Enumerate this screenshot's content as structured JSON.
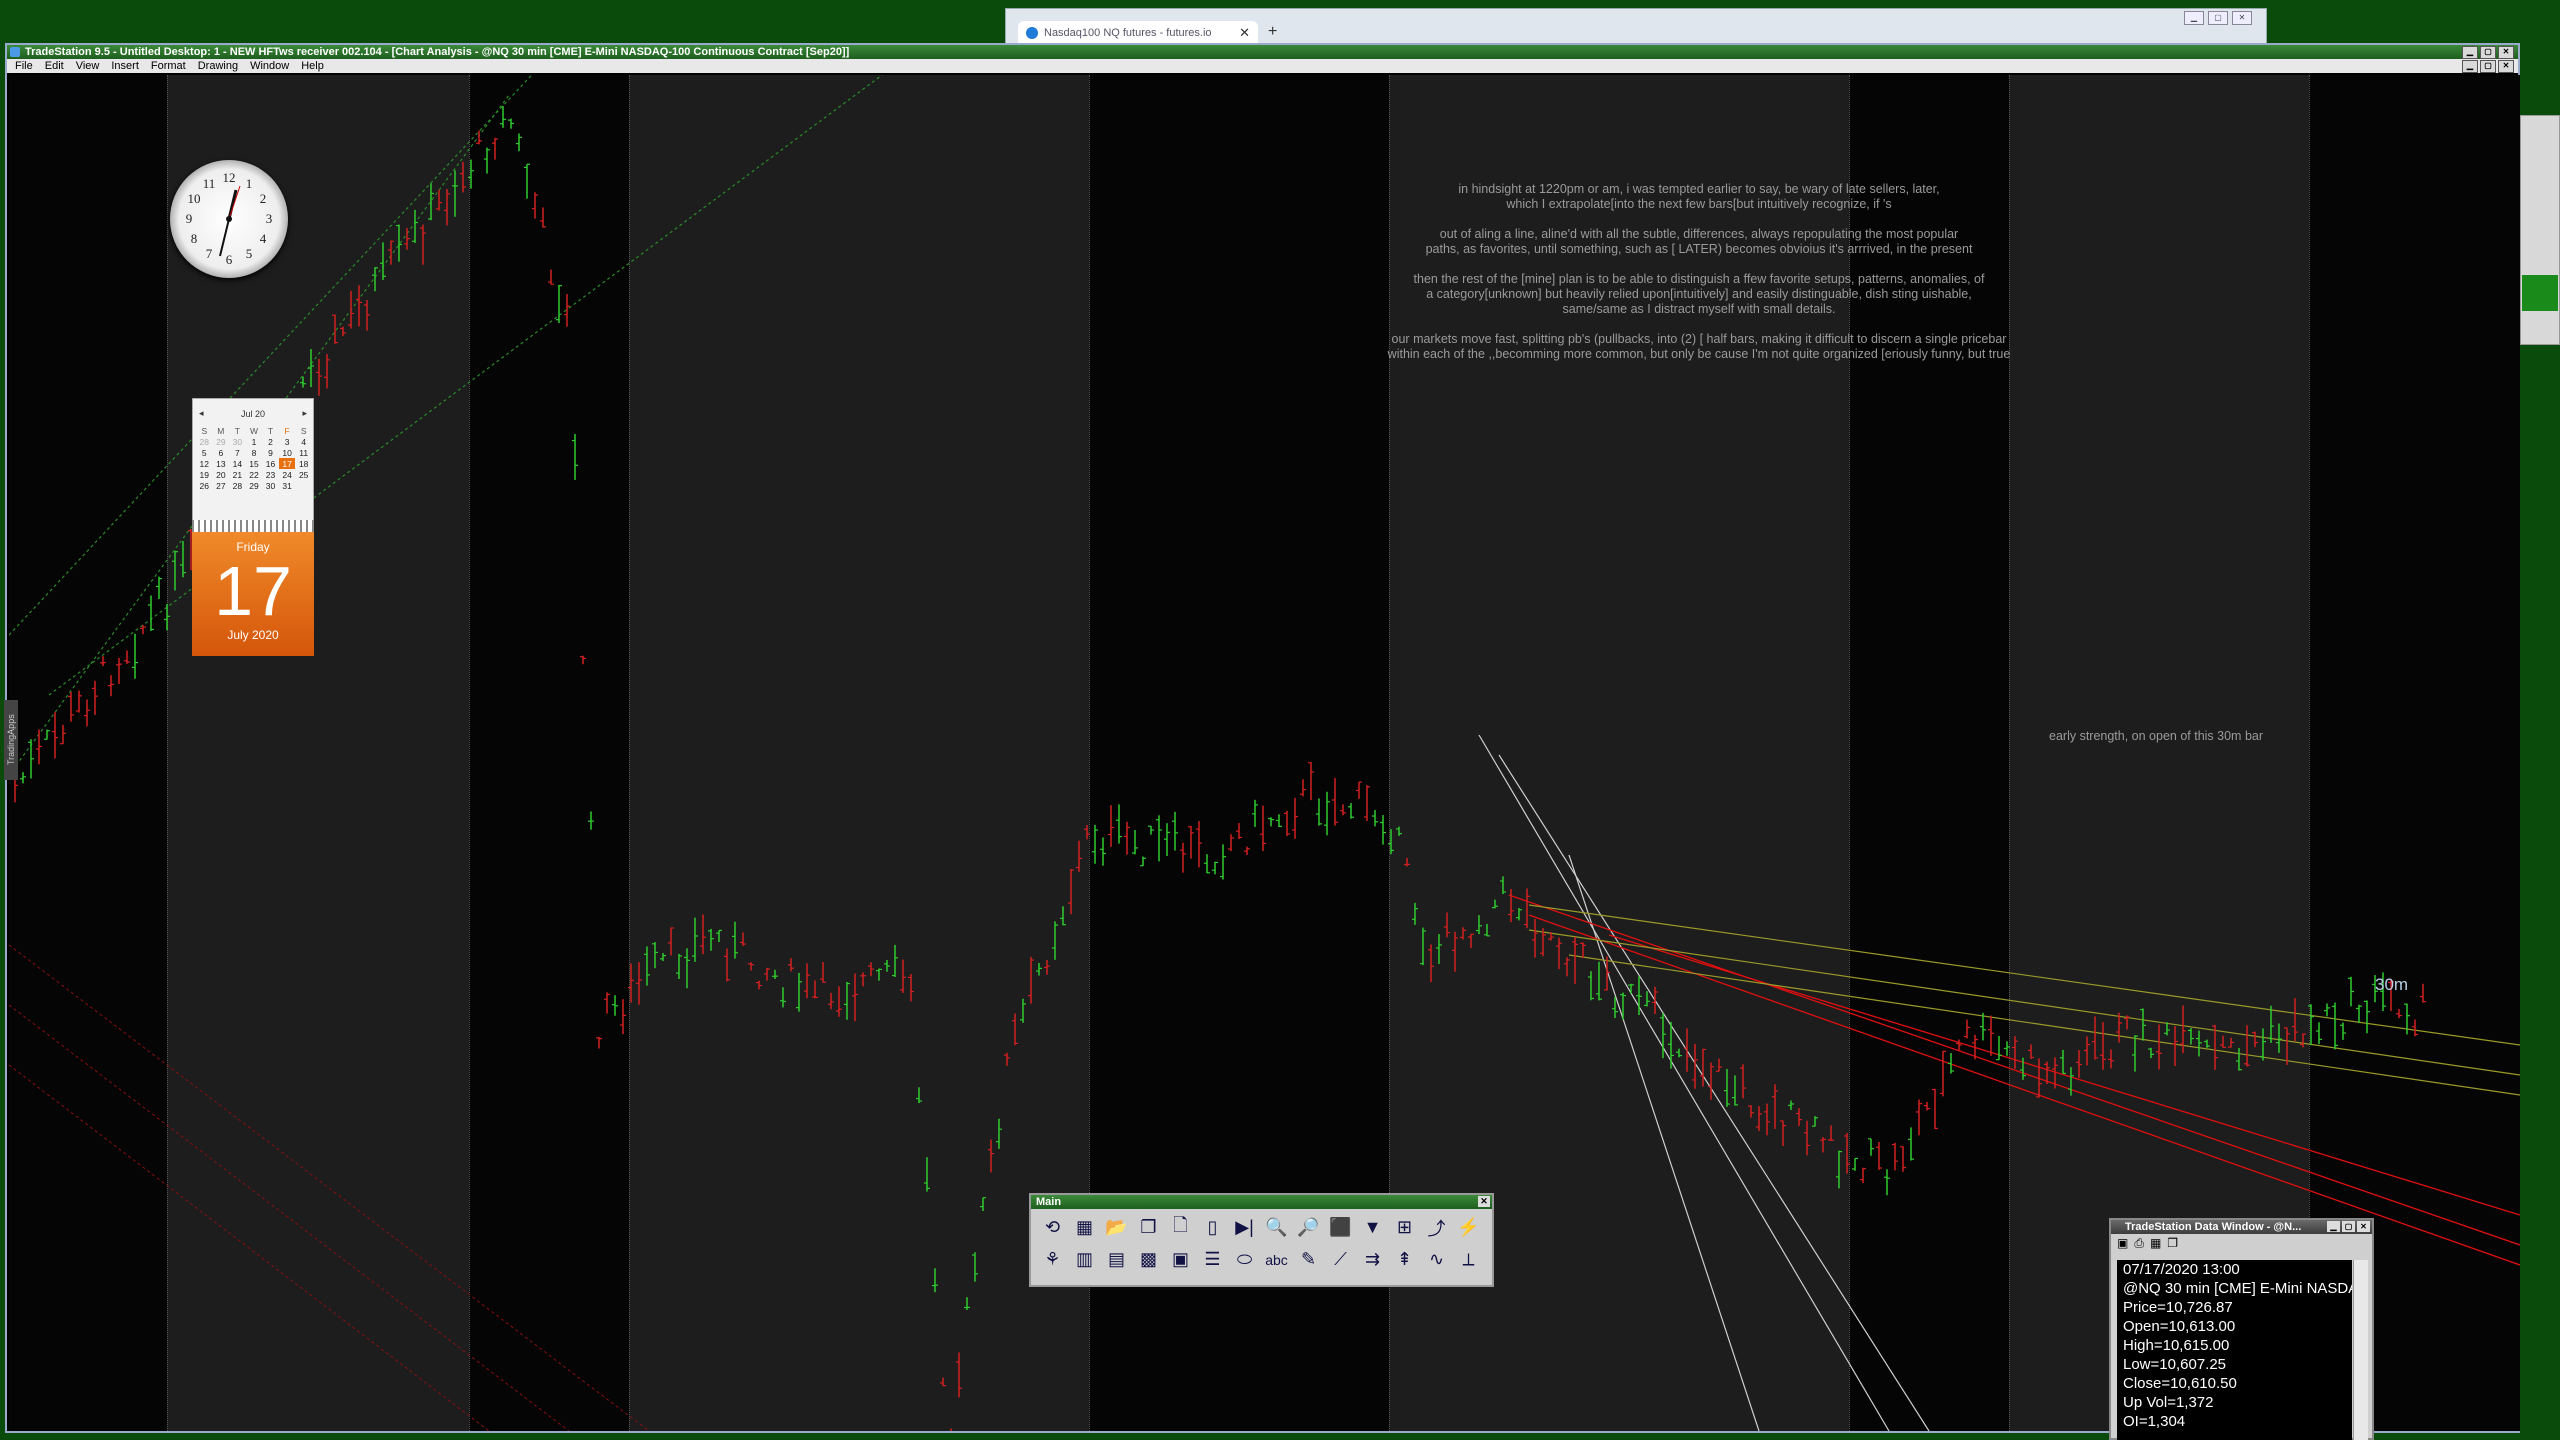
{
  "browser": {
    "tab_title": "Nasdaq100 NQ futures - futures.io",
    "new_tab": "+",
    "close": "✕"
  },
  "window": {
    "title": "TradeStation 9.5 - Untitled Desktop: 1 - NEW HFTws receiver 002.104 - [Chart Analysis - @NQ 30 min [CME] E-Mini NASDAQ-100 Continuous Contract [Sep20]]",
    "menu": [
      "File",
      "Edit",
      "View",
      "Insert",
      "Format",
      "Drawing",
      "Window",
      "Help"
    ]
  },
  "notes": {
    "line1": "in hindsight at 1220pm or am, i was tempted earlier to say, be wary of late sellers, later,",
    "line2": "which I extrapolate[into the next few bars[but intuitively recognize, if 's",
    "line3": "out of aling a line, aline'd with all the subtle, differences, always repopulating the most popular",
    "line4": "paths, as favorites, until something, such as [ LATER) becomes obvioius it's arrrived, in the present",
    "line5": "then the rest of the [mine] plan is to be able to distinguish a ffew favorite setups, patterns, anomalies, of",
    "line6": "a category[unknown] but heavily relied upon[intuitively] and easily distinguable, dish sting uishable,",
    "line7": "same/same as I distract myself with small details.",
    "line8": "our markets move fast, splitting pb's (pullbacks, into (2) [ half bars, making it difficult to discern a single pricebar",
    "line9": "within each of the ,,becomming more common, but only be cause I'm not quite organized [eriously funny, but true",
    "early": "early strength, on open of this 30m bar",
    "interval": "30m"
  },
  "calendar": {
    "month_label": "Jul 20",
    "weekday_headers": [
      "S",
      "M",
      "T",
      "W",
      "T",
      "F",
      "S"
    ],
    "weeks": [
      [
        "28",
        "29",
        "30",
        "1",
        "2",
        "3",
        "4"
      ],
      [
        "5",
        "6",
        "7",
        "8",
        "9",
        "10",
        "11"
      ],
      [
        "12",
        "13",
        "14",
        "15",
        "16",
        "17",
        "18"
      ],
      [
        "19",
        "20",
        "21",
        "22",
        "23",
        "24",
        "25"
      ],
      [
        "26",
        "27",
        "28",
        "29",
        "30",
        "31",
        ""
      ]
    ],
    "weekday": "Friday",
    "day": "17",
    "month_year": "July 2020"
  },
  "side_label": "TradingApps",
  "toolbar": {
    "title": "Main",
    "row1": [
      "⟲",
      "▦",
      "📂",
      "❐",
      "🗋",
      "▯",
      "▶|",
      "🔍",
      "🔎",
      "⬛",
      "▼",
      "⊞",
      "⤴",
      "⚡"
    ],
    "row2": [
      "⚘",
      "▥",
      "▤",
      "▩",
      "▣",
      "☰",
      "⬭",
      "abc",
      "✎",
      "⟋",
      "⇉",
      "⇞",
      "∿",
      "⟂"
    ]
  },
  "data_window": {
    "title": "TradeStation Data Window - @N...",
    "lines": [
      "07/17/2020 13:00",
      "@NQ 30 min [CME] E-Mini NASDAQ",
      "Price=10,726.87",
      "Open=10,613.00",
      "High=10,615.00",
      "Low=10,607.25",
      "Close=10,610.50",
      "Up Vol=1,372",
      "OI=1,304"
    ]
  },
  "colors": {
    "up_bar": "#2ecc2e",
    "down_bar": "#d42020",
    "session_shade": "#1d1d1d",
    "trend_green": "#2a8a2a",
    "trend_red": "#e01010",
    "trend_yellow": "#9a9a2a"
  }
}
